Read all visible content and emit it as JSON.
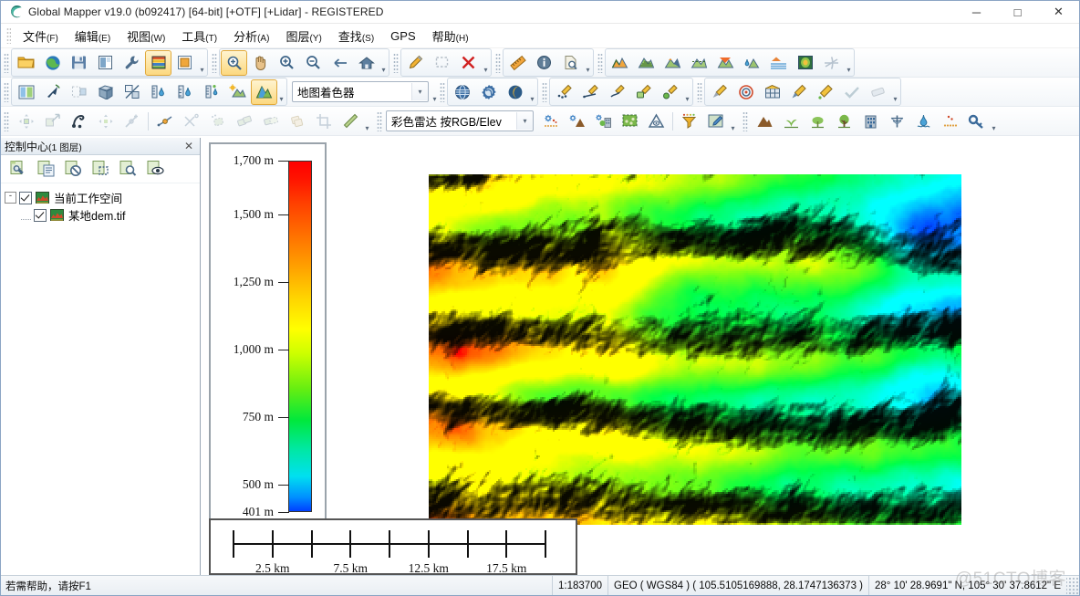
{
  "window": {
    "title": "Global Mapper v19.0 (b092417) [64-bit] [+OTF] [+Lidar] - REGISTERED",
    "logo_icon": "globe-logo-icon",
    "minimize_label": "─",
    "maximize_label": "□",
    "close_label": "✕"
  },
  "menu": [
    {
      "label": "文件",
      "mnemonic": "(F)"
    },
    {
      "label": "编辑",
      "mnemonic": "(E)"
    },
    {
      "label": "视图",
      "mnemonic": "(W)"
    },
    {
      "label": "工具",
      "mnemonic": "(T)"
    },
    {
      "label": "分析",
      "mnemonic": "(A)"
    },
    {
      "label": "图层",
      "mnemonic": "(Y)"
    },
    {
      "label": "查找",
      "mnemonic": "(S)"
    },
    {
      "label": "GPS",
      "mnemonic": ""
    },
    {
      "label": "帮助",
      "mnemonic": "(H)"
    }
  ],
  "toolbar_row1": {
    "group_file": [
      "open-folder-icon",
      "open-online-data-icon",
      "save-workspace-icon",
      "print-icon",
      "configure-wrench-icon",
      "control-center-icon",
      "overlay-manager-icon"
    ],
    "group_nav": [
      "zoom-select-icon",
      "pan-hand-icon",
      "zoom-in-icon",
      "zoom-out-icon",
      "previous-view-arrow-icon",
      "full-view-home-icon"
    ],
    "group_edit": [
      "digitizer-pencil-icon",
      "select-lasso-icon",
      "delete-red-x-icon"
    ],
    "group_measure": [
      "measure-ruler-icon",
      "feature-info-icon",
      "search-document-icon"
    ],
    "group_terrain": [
      "elevation-profile-icon",
      "contour-generate-icon",
      "watershed-icon",
      "view-shed-icon",
      "cut-fill-volume-icon",
      "water-level-rise-icon",
      "terrain-layers-icon",
      "color-raster-icon",
      "path-profile-icon"
    ]
  },
  "toolbar_row2": {
    "group_a": [
      "split-view-icon",
      "select-feature-arrow-icon",
      "crop-layer-icon",
      "view-3d-icon",
      "compare-layers-icon",
      "water-depth-icon",
      "water-level-icon",
      "sensor-depth-icon",
      "terrain-sun-icon",
      "terrain-shader-icon"
    ],
    "shader_combo": {
      "value": "地图着色器",
      "arrow": "▾"
    },
    "group_b": [
      "projection-globe-icon",
      "globe-gear-icon",
      "globe-shadow-icon"
    ],
    "group_c": [
      "lidar-points-icon",
      "lidar-line-icon",
      "lidar-path-icon",
      "lidar-area-icon",
      "lidar-point-green-icon"
    ],
    "group_d": [
      "lidar-paint-icon",
      "lidar-target-icon",
      "lidar-grid-icon",
      "lidar-brush-icon",
      "lidar-edit-icon",
      "apply-check-icon",
      "cancel-eraser-icon"
    ]
  },
  "toolbar_row3": {
    "group_a": [
      "move-feature-icon",
      "scale-feature-icon",
      "rotate-feature-icon",
      "move-vertex-icon",
      "add-vertex-icon"
    ],
    "group_b": [
      "split-line-icon",
      "cut-line-scissors-icon",
      "copy-area-icon",
      "combine-areas-icon",
      "crop-areas-icon",
      "duplicate-area-icon",
      "crop-tool-icon",
      "measure-pencil-icon"
    ],
    "lidar_combo": {
      "value": "彩色雷达 按RGB/Elev",
      "arrow": "▾"
    },
    "group_c": [
      "lidar-classify-icon",
      "lidar-ground-icon",
      "lidar-building-veg-icon",
      "lidar-area-classify-icon",
      "lidar-warning-icon",
      "lidar-filter-icon",
      "lidar-picker-icon"
    ],
    "group_d": [
      "class-ground-icon",
      "class-low-veg-icon",
      "class-med-veg-icon",
      "class-high-veg-icon",
      "class-building-icon",
      "class-powerline-icon",
      "class-water-icon",
      "class-noise-icon",
      "class-key-icon"
    ]
  },
  "control_center": {
    "title": "控制中心",
    "subtitle": "(1 图层)",
    "close_label": "✕",
    "tools": [
      "layer-options-icon",
      "layer-metadata-icon",
      "layer-close-icon",
      "layer-crop-icon",
      "layer-zoom-icon",
      "layer-visibility-icon"
    ],
    "tree": [
      {
        "label": "当前工作空间",
        "icon": "workspace-raster-icon",
        "checked": true,
        "expander": "-",
        "level": 0
      },
      {
        "label": "某地dem.tif",
        "icon": "raster-layer-icon",
        "checked": true,
        "expander": "",
        "level": 1
      }
    ]
  },
  "legend": {
    "unit": "m",
    "entries": [
      {
        "label": "1,700 m",
        "pct": 0
      },
      {
        "label": "1,500 m",
        "pct": 15.4
      },
      {
        "label": "1,250 m",
        "pct": 34.6
      },
      {
        "label": "1,000 m",
        "pct": 53.8
      },
      {
        "label": "750 m",
        "pct": 73.1
      },
      {
        "label": "500 m",
        "pct": 92.3
      },
      {
        "label": "401 m",
        "pct": 100
      }
    ]
  },
  "scalebar": {
    "tick_count": 9,
    "labels": [
      {
        "text": "2.5 km",
        "pct": 12.5
      },
      {
        "text": "7.5 km",
        "pct": 37.5
      },
      {
        "text": "12.5 km",
        "pct": 62.5
      },
      {
        "text": "17.5 km",
        "pct": 87.5
      }
    ]
  },
  "statusbar": {
    "help_text": "若需帮助，请按F1",
    "scale": "1:183700",
    "projection": "GEO ( WGS84 ) ( 105.5105169888, 28.1747136373 )",
    "coordinates": "28° 10' 28.9691\" N, 105° 30' 37.8612\" E"
  },
  "watermark": "@51CTO博客",
  "colors": {
    "accent": "#e0a93c",
    "panel_border": "#9aa7b5",
    "legend_high": "#ff0000",
    "legend_low": "#0040ff"
  }
}
